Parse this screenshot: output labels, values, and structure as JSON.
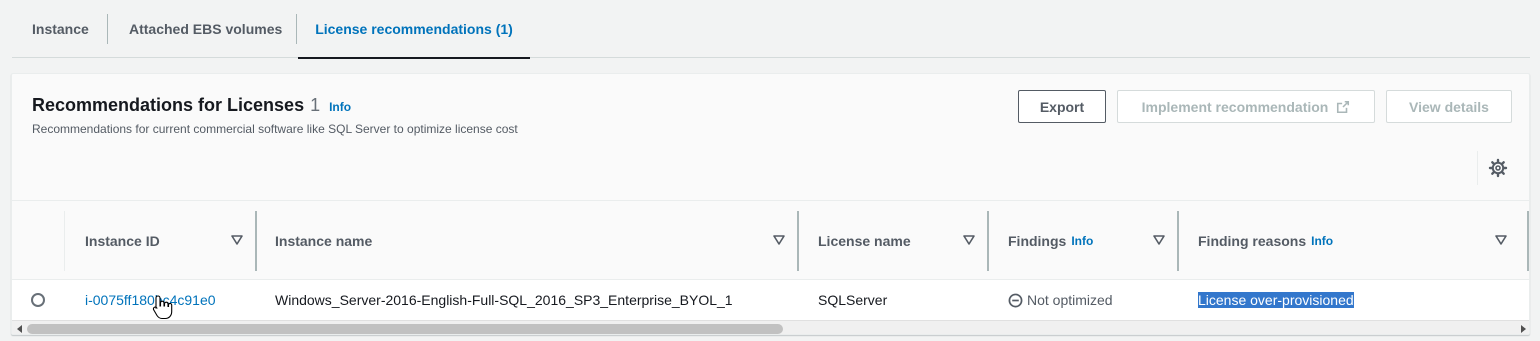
{
  "tabs": [
    {
      "label": "Instance"
    },
    {
      "label": "Attached EBS volumes"
    },
    {
      "label": "License recommendations (1)"
    }
  ],
  "panel": {
    "title": "Recommendations for Licenses",
    "count": "1",
    "info": "Info",
    "description": "Recommendations for current commercial software like SQL Server to optimize license cost",
    "export_label": "Export",
    "implement_label": "Implement recommendation",
    "view_details_label": "View details"
  },
  "table": {
    "columns": [
      {
        "label": "Instance ID",
        "info": ""
      },
      {
        "label": "Instance name",
        "info": ""
      },
      {
        "label": "License name",
        "info": ""
      },
      {
        "label": "Findings",
        "info": "Info"
      },
      {
        "label": "Finding reasons",
        "info": "Info"
      }
    ],
    "rows": [
      {
        "instance_id": "i-0075ff180bc4c91e0",
        "instance_name": "Windows_Server-2016-English-Full-SQL_2016_SP3_Enterprise_BYOL_1",
        "license_name": "SQLServer",
        "findings": "Not optimized",
        "finding_reasons": "License over-provisioned"
      }
    ]
  },
  "colors": {
    "accent": "#0073bb",
    "selected_tab_underline": "#16191f",
    "highlight": "#3377cc"
  },
  "icons": [
    "external-link-icon",
    "gear-icon",
    "sort-caret-icon",
    "not-optimized-icon",
    "hand-cursor-icon"
  ]
}
